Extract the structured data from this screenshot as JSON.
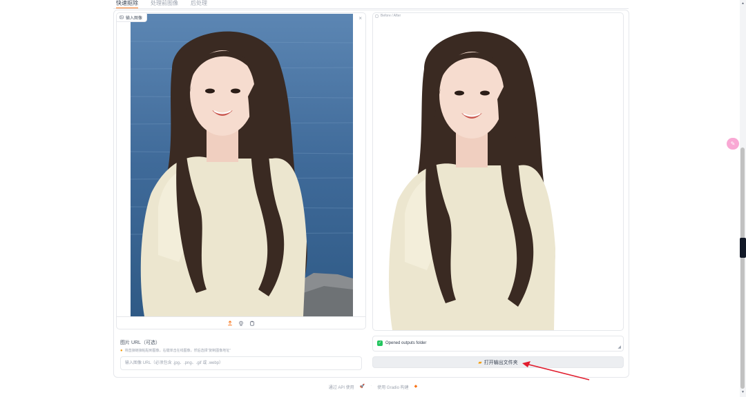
{
  "tabs": [
    {
      "label": "快速抠除",
      "active": true
    },
    {
      "label": "处理前图像",
      "active": false
    },
    {
      "label": "后处理",
      "active": false
    }
  ],
  "input_image": {
    "label": "输入图像",
    "clear_icon": "×",
    "tools": [
      "upload-icon",
      "webcam-icon",
      "clipboard-icon"
    ]
  },
  "url_section": {
    "title": "图片 URL（可选）",
    "hint": "将直接链接粘贴到图像，右键单击在线图像，然后选择“复制图像地址”",
    "placeholder": "输入图像 URL（必须包含 .jpg、.png、.gif 或 .webp）"
  },
  "output_image": {
    "label": "Before / After"
  },
  "status": {
    "text": "Opened outputs folder",
    "checked": true
  },
  "open_button": {
    "label": "打开输出文件夹",
    "icon": "folder-icon"
  },
  "footer": {
    "api_link": "通过 API 使用",
    "separator": "·",
    "built_with": "使用 Gradio 构建"
  },
  "colors": {
    "accent": "#f97316",
    "success": "#22c55e",
    "annotation_arrow": "#e11d2e",
    "water": "#3f6a99"
  }
}
